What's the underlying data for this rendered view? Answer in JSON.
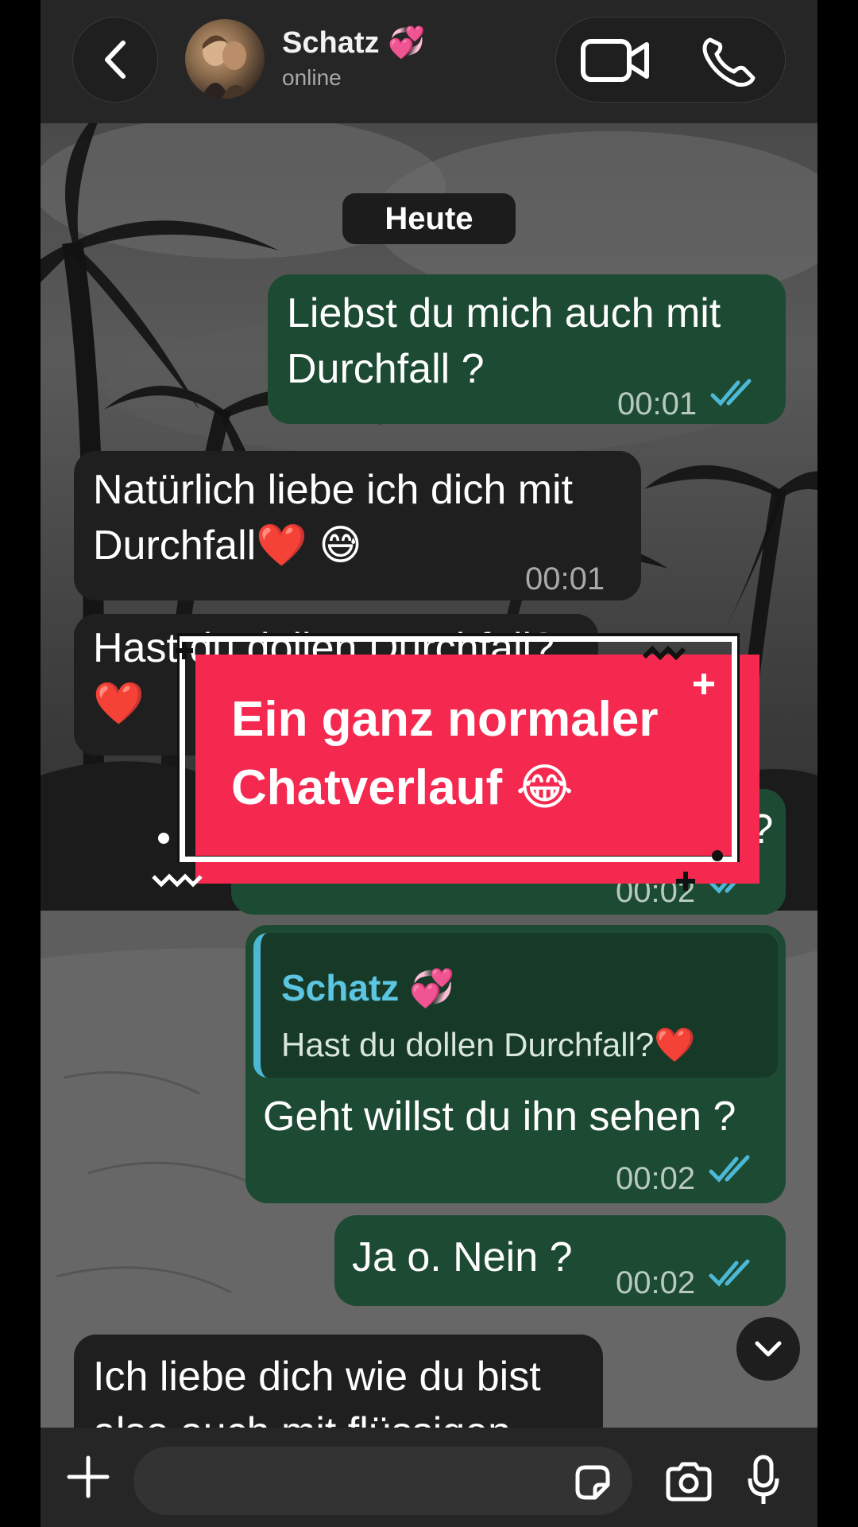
{
  "header": {
    "contact_name": "Schatz 💞",
    "status": "online"
  },
  "chat": {
    "date_chip": "Heute",
    "messages": [
      {
        "direction": "out",
        "text_line1": "Liebst du mich auch mit",
        "text_line2": "Durchfall ?",
        "time": "00:01",
        "read": true
      },
      {
        "direction": "in",
        "text_line1": "Natürlich liebe ich dich mit",
        "text_line2": "Durchfall❤️ 😅",
        "time": "00:01"
      },
      {
        "direction": "in",
        "text_line1": "Hast du dollen Durchfall?",
        "text_line2": "❤️"
      },
      {
        "direction": "out",
        "text_tail": "n ?",
        "time": "00:02",
        "read": true
      },
      {
        "direction": "out",
        "reply_to_name": "Schatz 💞",
        "reply_to_text": "Hast du dollen Durchfall?❤️",
        "text_line1": "Geht willst du ihn sehen ?",
        "time": "00:02",
        "read": true
      },
      {
        "direction": "out",
        "text_line1": "Ja o. Nein ?",
        "time": "00:02",
        "read": true
      },
      {
        "direction": "in",
        "text_line1": "Ich liebe dich wie du bist",
        "text_line2": "also auch mit flüssigen"
      }
    ]
  },
  "overlay": {
    "line1": "Ein ganz normaler",
    "line2": "Chatverlauf 😂"
  },
  "colors": {
    "outgoing_bubble": "#1d4a32",
    "incoming_bubble": "#1f1f1f",
    "read_ticks": "#4db8d6",
    "sticker": "#f5294f"
  },
  "icons": [
    "chevron-left-icon",
    "video-camera-icon",
    "phone-icon",
    "chevron-down-icon",
    "plus-icon",
    "sticker-icon",
    "camera-icon",
    "microphone-icon",
    "double-check-icon"
  ]
}
